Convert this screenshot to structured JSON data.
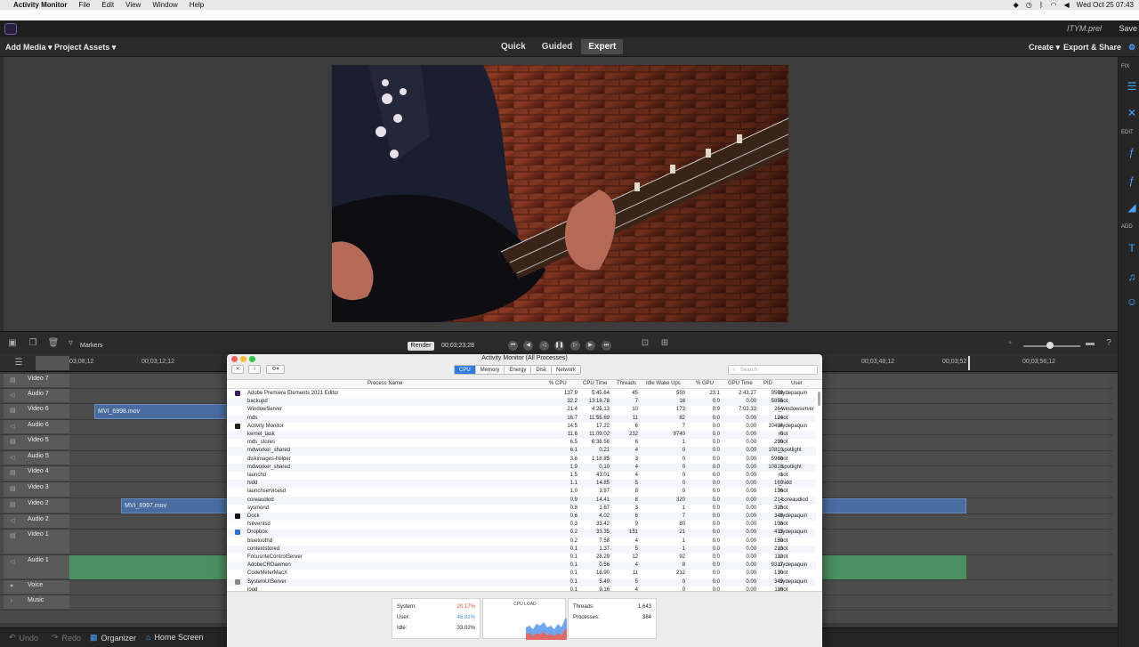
{
  "menubar": {
    "app": "Activity Monitor",
    "items": [
      "File",
      "Edit",
      "View",
      "Window",
      "Help"
    ],
    "clock": "Wed Oct 25  07:43"
  },
  "titlebar": {
    "filename": "ITYM.prel",
    "save": "Save"
  },
  "toolbar": {
    "add_media": "Add Media ▾",
    "project_assets": "Project Assets ▾",
    "modes": [
      "Quick",
      "Guided",
      "Expert"
    ],
    "active_mode": "Expert",
    "create": "Create ▾",
    "export": "Export & Share"
  },
  "rightpanel": {
    "labels": [
      "FIX",
      "EDIT",
      "ADD"
    ]
  },
  "controls": {
    "markers": "Markers",
    "render": "Render",
    "timecode": "00;03;23;28"
  },
  "ruler": [
    "03;08;12",
    "00;03;12;12",
    "00;03;48;12",
    "00;03;52",
    "00;03;56;12"
  ],
  "tracks": [
    {
      "name": "Video 7",
      "kind": "v"
    },
    {
      "name": "Audio 7",
      "kind": "a"
    },
    {
      "name": "Video 6",
      "kind": "v",
      "clip": "MVI_6998.mov"
    },
    {
      "name": "Audio 6",
      "kind": "a"
    },
    {
      "name": "Video 5",
      "kind": "v"
    },
    {
      "name": "Audio 5",
      "kind": "a"
    },
    {
      "name": "Video 4",
      "kind": "v"
    },
    {
      "name": "Video 3",
      "kind": "v"
    },
    {
      "name": "Video 2",
      "kind": "v",
      "clip": "MVI_6997.mov"
    },
    {
      "name": "Audio 2",
      "kind": "a"
    },
    {
      "name": "Video 1",
      "kind": "v"
    },
    {
      "name": "Audio 1",
      "kind": "a"
    },
    {
      "name": "Voice",
      "kind": "voice"
    },
    {
      "name": "Music",
      "kind": "music"
    }
  ],
  "bottombar": {
    "undo": "Undo",
    "redo": "Redo",
    "organizer": "Organizer",
    "home": "Home Screen"
  },
  "activity_monitor": {
    "title": "Activity Monitor (All Processes)",
    "tabs": [
      "CPU",
      "Memory",
      "Energy",
      "Disk",
      "Network"
    ],
    "active_tab": "CPU",
    "search_placeholder": "Search",
    "columns": [
      "Process Name",
      "% CPU",
      "CPU Time",
      "Threads",
      "Idle Wake Ups",
      "% GPU",
      "GPU Time",
      "PID",
      "User"
    ],
    "rows": [
      [
        "Adobe Premiere Elements 2021 Editor",
        "137.9",
        "5:45.64",
        "45",
        "550",
        "23.1",
        "2:43.27",
        "9568",
        "clydepaquin"
      ],
      [
        "backupd",
        "32.2",
        "13:18.78",
        "7",
        "16",
        "0.0",
        "0.00",
        "5855",
        "root"
      ],
      [
        "WindowServer",
        "21.4",
        "4:25.13",
        "10",
        "173",
        "0.9",
        "7:03.33",
        "264",
        "_windowserver"
      ],
      [
        "mds",
        "16.7",
        "11:55.69",
        "11",
        "82",
        "0.0",
        "0.00",
        "124",
        "root"
      ],
      [
        "Activity Monitor",
        "14.5",
        "17.22",
        "6",
        "7",
        "0.0",
        "0.00",
        "10494",
        "clydepaquin"
      ],
      [
        "kernel_task",
        "11.6",
        "11:09.02",
        "232",
        "9740",
        "0.0",
        "0.00",
        "0",
        "root"
      ],
      [
        "mds_stores",
        "6.5",
        "6:36.56",
        "6",
        "1",
        "0.0",
        "0.00",
        "299",
        "root"
      ],
      [
        "mdworker_shared",
        "6.1",
        "0.21",
        "4",
        "0",
        "0.0",
        "0.00",
        "10810",
        "_spotlight"
      ],
      [
        "diskimages-helper",
        "3.6",
        "1:18.85",
        "3",
        "0",
        "0.0",
        "0.00",
        "5968",
        "root"
      ],
      [
        "mdworker_shared",
        "1.9",
        "0.10",
        "4",
        "0",
        "0.0",
        "0.00",
        "10818",
        "_spotlight"
      ],
      [
        "launchd",
        "1.5",
        "43.01",
        "4",
        "0",
        "0.0",
        "0.00",
        "1",
        "root"
      ],
      [
        "hidd",
        "1.1",
        "14.85",
        "5",
        "0",
        "0.0",
        "0.00",
        "160",
        "_hidd"
      ],
      [
        "launchservicesd",
        "1.0",
        "3.97",
        "8",
        "0",
        "0.0",
        "0.00",
        "136",
        "root"
      ],
      [
        "coreaudiod",
        "0.9",
        "14.41",
        "8",
        "320",
        "0.0",
        "0.00",
        "214",
        "_coreaudiod"
      ],
      [
        "sysmond",
        "0.8",
        "1.67",
        "3",
        "1",
        "0.0",
        "0.00",
        "325",
        "root"
      ],
      [
        "Dock",
        "0.6",
        "4.02",
        "6",
        "7",
        "0.0",
        "0.00",
        "348",
        "clydepaquin"
      ],
      [
        "fseventsd",
        "0.3",
        "33.42",
        "9",
        "80",
        "0.0",
        "0.00",
        "103",
        "root"
      ],
      [
        "Dropbox",
        "0.2",
        "33.35",
        "151",
        "21",
        "0.0",
        "0.00",
        "433",
        "clydepaquin"
      ],
      [
        "bluetoothd",
        "0.2",
        "7.58",
        "4",
        "1",
        "0.0",
        "0.00",
        "159",
        "root"
      ],
      [
        "contextstored",
        "0.1",
        "1.37",
        "5",
        "1",
        "0.0",
        "0.00",
        "213",
        "root"
      ],
      [
        "FocusriteControlServer",
        "0.1",
        "28.29",
        "12",
        "92",
        "0.0",
        "0.00",
        "112",
        "root"
      ],
      [
        "AdobeCRDaemon",
        "0.1",
        "0.56",
        "4",
        "8",
        "0.0",
        "0.00",
        "9317",
        "clydepaquin"
      ],
      [
        "CodeMeterMacX",
        "0.1",
        "16.90",
        "11",
        "212",
        "0.0",
        "0.00",
        "130",
        "root"
      ],
      [
        "SystemUIServer",
        "0.1",
        "5.49",
        "5",
        "0",
        "0.0",
        "0.00",
        "349",
        "clydepaquin"
      ],
      [
        "logd",
        "0.1",
        "9.16",
        "4",
        "0",
        "0.0",
        "0.00",
        "116",
        "root"
      ]
    ],
    "footer": {
      "system_label": "System:",
      "system_value": "20.17%",
      "user_label": "User:",
      "user_value": "46.81%",
      "idle_label": "Idle:",
      "idle_value": "33.02%",
      "cpu_load": "CPU LOAD",
      "threads_label": "Threads:",
      "threads_value": "1,643",
      "processes_label": "Processes:",
      "processes_value": "384"
    },
    "colors": {
      "system": "#e0443a",
      "user": "#3f8ee8"
    }
  }
}
